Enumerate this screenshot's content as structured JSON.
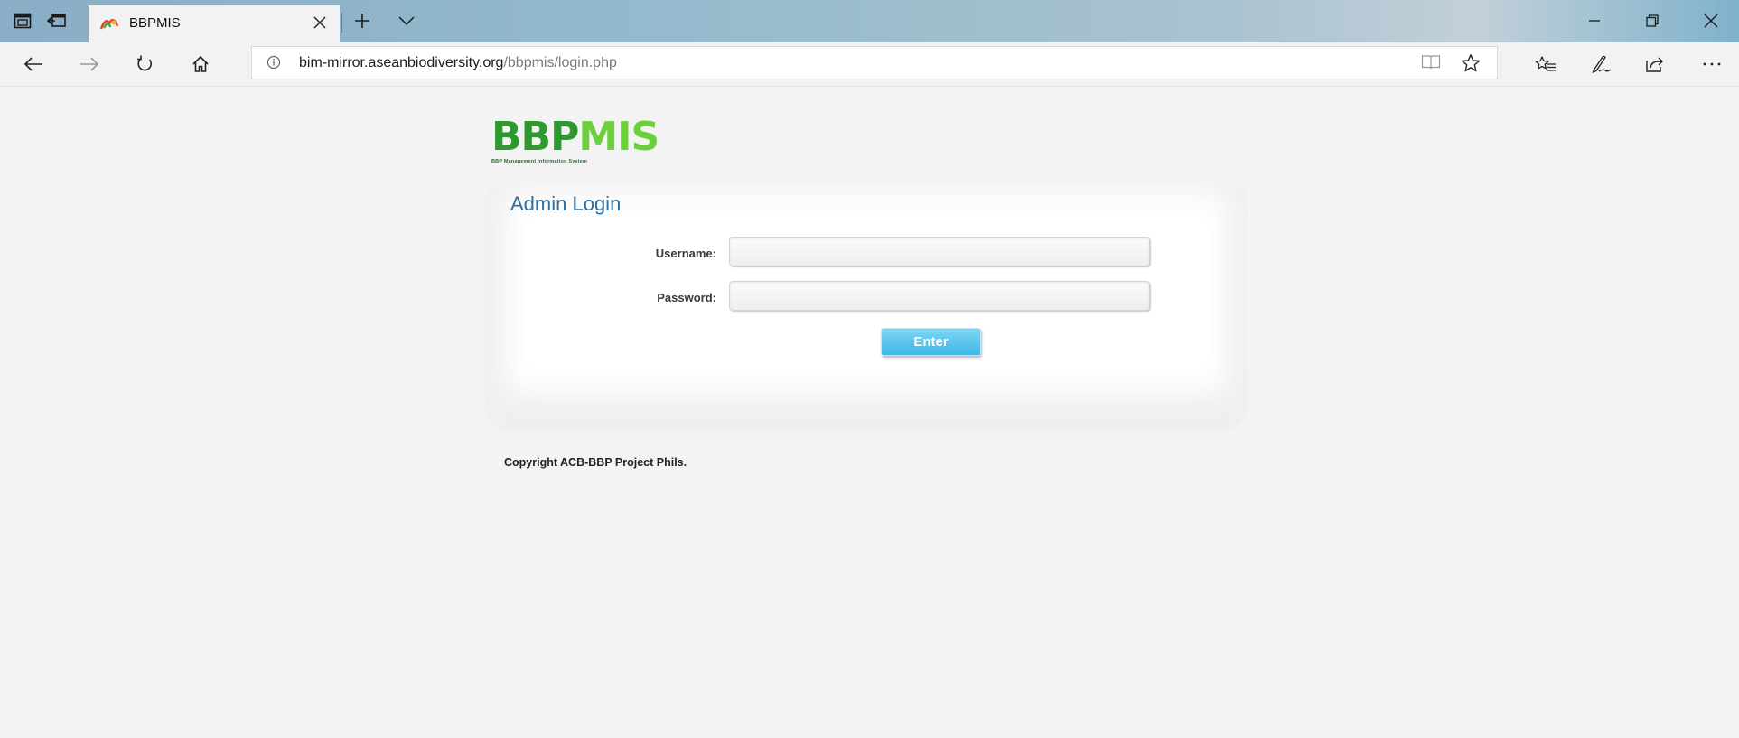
{
  "browser": {
    "tab": {
      "title": "BBPMIS",
      "favicon": "bbpmis-favicon"
    },
    "address": {
      "domain": "bim-mirror.aseanbiodiversity.org",
      "path": "/bbpmis/login.php"
    },
    "icons": {
      "tab_preview": "tab-preview-icon",
      "set_aside_tabs": "set-aside-tabs-icon",
      "close_tab": "close-icon",
      "new_tab": "plus-icon",
      "tab_list": "chevron-down-icon",
      "minimize": "minimize-icon",
      "restore": "restore-icon",
      "close_window": "close-icon",
      "back": "back-arrow-icon",
      "forward": "forward-arrow-icon",
      "refresh": "refresh-icon",
      "home": "home-icon",
      "site_info": "info-icon",
      "reading_view": "reading-view-icon",
      "favorite": "star-icon",
      "favorites_hub": "favorites-list-icon",
      "web_note": "pen-icon",
      "share": "share-icon",
      "more": "more-icon"
    }
  },
  "page": {
    "logo": {
      "part1": "BBP",
      "part2": "MIS",
      "tagline": "BBP Management Information System",
      "color1": "#2e9a2e",
      "color2": "#6ccf3c"
    },
    "login": {
      "heading": "Admin Login",
      "username_label": "Username:",
      "username_value": "",
      "password_label": "Password:",
      "password_value": "",
      "submit_label": "Enter"
    },
    "footer": "Copyright ACB-BBP Project Phils."
  },
  "colors": {
    "accent_button": "#3eb6e8",
    "heading": "#2e6fa0"
  }
}
